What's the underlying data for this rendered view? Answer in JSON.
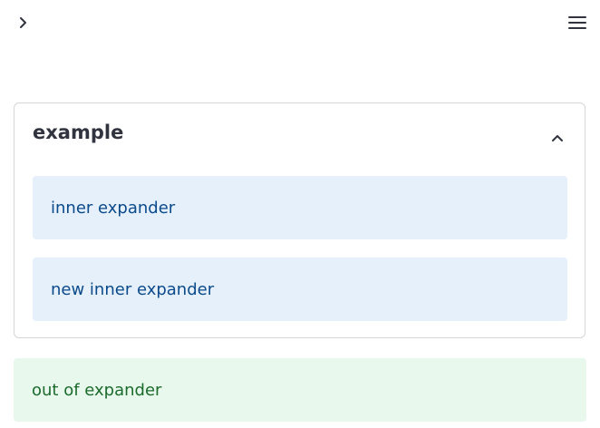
{
  "icons": {
    "sidebar_toggle": "chevron-right-icon",
    "menu": "hamburger-menu-icon",
    "expander_toggle": "chevron-up-icon"
  },
  "expander": {
    "title": "example",
    "expanded": true,
    "items": [
      {
        "label": "inner expander"
      },
      {
        "label": "new inner expander"
      }
    ]
  },
  "footer_message": {
    "label": "out of expander"
  },
  "colors": {
    "text": "#31333f",
    "info_bg": "#e6f0fb",
    "info_text": "#0b4a8a",
    "success_bg": "#e8f8ec",
    "success_text": "#1b6b2d",
    "border": "#d6d6d9"
  }
}
